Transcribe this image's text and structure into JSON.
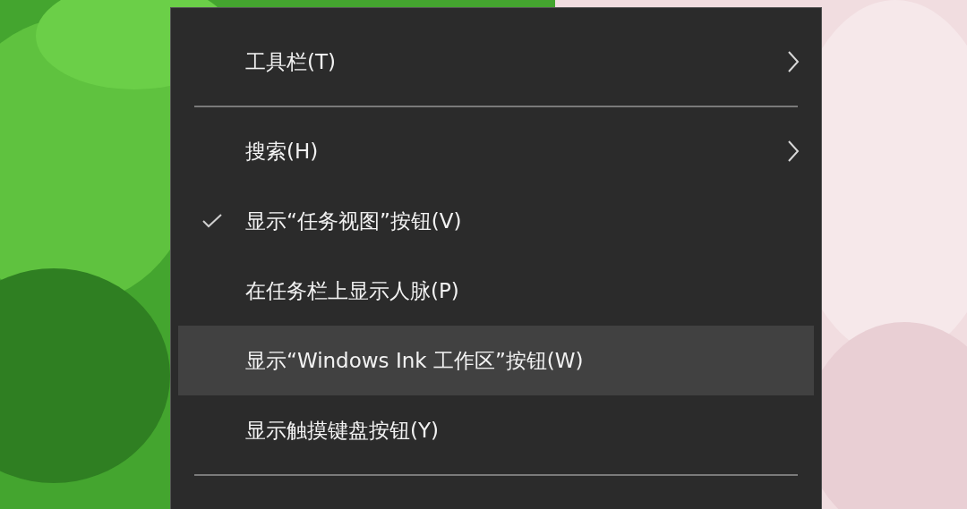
{
  "menu": {
    "items": [
      {
        "kind": "item",
        "label": "工具栏(T)",
        "checked": false,
        "submenu": true,
        "selected": false
      },
      {
        "kind": "separator"
      },
      {
        "kind": "item",
        "label": "搜索(H)",
        "checked": false,
        "submenu": true,
        "selected": false
      },
      {
        "kind": "item",
        "label": "显示“任务视图”按钮(V)",
        "checked": true,
        "submenu": false,
        "selected": false
      },
      {
        "kind": "item",
        "label": "在任务栏上显示人脉(P)",
        "checked": false,
        "submenu": false,
        "selected": false
      },
      {
        "kind": "item",
        "label": "显示“Windows Ink 工作区”按钮(W)",
        "checked": false,
        "submenu": false,
        "selected": true
      },
      {
        "kind": "item",
        "label": "显示触摸键盘按钮(Y)",
        "checked": false,
        "submenu": false,
        "selected": false
      },
      {
        "kind": "separator"
      }
    ]
  }
}
